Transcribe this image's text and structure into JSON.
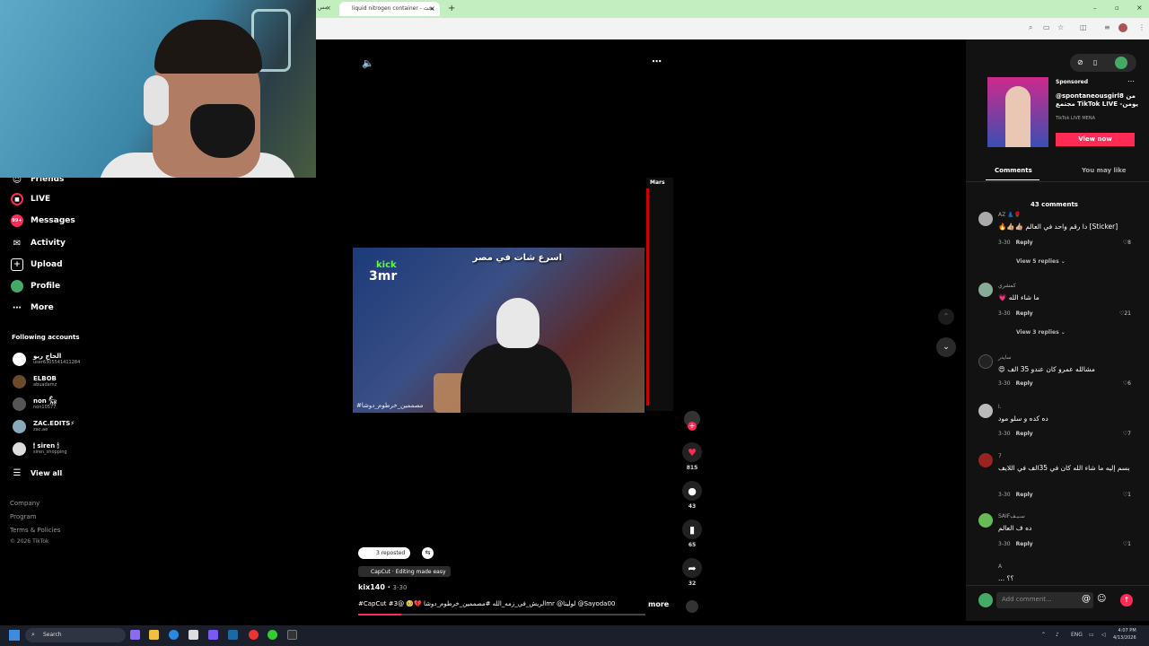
{
  "browser": {
    "tab_title": "liquid nitrogen container - بحث",
    "tab_close": "×",
    "new_tab": "+",
    "left_tab_fragment": "مس"
  },
  "video": {
    "overlay_text": "اسرع شات في مصر",
    "kick_label": "kick",
    "channel_label": "3mr",
    "caption_overlay": "#مصممين_خرطوم_دوشا",
    "live_chat_name": "Mars"
  },
  "sidebar": {
    "items": [
      {
        "label": "Friends",
        "icon": "friends-icon"
      },
      {
        "label": "LIVE",
        "icon": "live-icon"
      },
      {
        "label": "Messages",
        "icon": "messages-icon",
        "badge": "99+"
      },
      {
        "label": "Activity",
        "icon": "activity-icon"
      },
      {
        "label": "Upload",
        "icon": "upload-icon"
      },
      {
        "label": "Profile",
        "icon": "profile-icon"
      },
      {
        "label": "More",
        "icon": "more-icon"
      }
    ],
    "following_heading": "Following accounts",
    "accounts": [
      {
        "name": "الحاج ربو",
        "user": "user6305541411284"
      },
      {
        "name": "ELBOB",
        "user": "abuadamz"
      },
      {
        "name": "non 𓃵",
        "user": "non10577"
      },
      {
        "name": "ZAC.EDITS⚡",
        "user": "zac.ae"
      },
      {
        "name": "🕯 siren 🕯",
        "user": "siren_shopping"
      }
    ],
    "view_all": "View all",
    "footer": [
      "Company",
      "Program",
      "Terms & Policies",
      "© 2026 TikTok"
    ]
  },
  "post": {
    "reposted": "3 reposted",
    "capcut": "CapCut · Editing made easy",
    "author": "kix140",
    "date": "3-30",
    "description": "#CapCut #الريش_في_زمه_الله #مصممين_خرطوم_دوشا 💔🥺 @3mr @لوليتا @Sayoda00",
    "more": "more",
    "likes": "815",
    "comments": "43",
    "saves": "65",
    "shares": "32"
  },
  "ad": {
    "sponsored": "Sponsored",
    "title": "@spontaneousgirl8 من مجتمع TikTok LIVE -يومن",
    "sub": "TikTok LIVE MENA",
    "cta": "View now"
  },
  "comments_panel": {
    "tab_comments": "Comments",
    "tab_like": "You may like",
    "count": "43 comments",
    "items": [
      {
        "user": "AZ 👗🌹",
        "text": "[Sticker] دا رقم واحد في العالم 👍🏼👍🏼🔥",
        "date": "3-30",
        "likes": "8",
        "replies": "View 5 replies ⌄"
      },
      {
        "user": "كمشري",
        "text": "ما شاء الله 💗",
        "date": "3-30",
        "likes": "21",
        "replies": "View 3 replies ⌄"
      },
      {
        "user": "سايدر",
        "text": "مشالله عمرو كان عندو 35 الف 😍",
        "date": "3-30",
        "likes": "6"
      },
      {
        "user": "ا.",
        "text": "ده كده و سلو مود",
        "date": "3-30",
        "likes": "7"
      },
      {
        "user": "7",
        "text": "بسم إليه ما شاء الله كان في 35الف في اللايف",
        "date": "3-30",
        "likes": "1"
      },
      {
        "user": "SAIFسـيـف",
        "text": "ده ف العالم",
        "date": "3-30",
        "likes": "1"
      },
      {
        "user": "A",
        "text": "؟؟ ...",
        "date": "",
        "likes": ""
      }
    ],
    "reply_label": "Reply",
    "add_placeholder": "Add comment..."
  },
  "taskbar": {
    "search": "Search",
    "lang": "ENG",
    "time": "4:07 PM",
    "date": "4/13/2026"
  },
  "colors": {
    "accent": "#fe2c55",
    "panel": "#121212"
  }
}
